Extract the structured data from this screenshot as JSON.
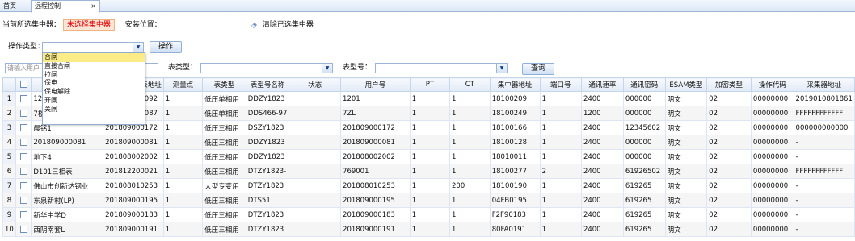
{
  "tabs": {
    "home": "首页",
    "remote": "远程控制",
    "close": "×"
  },
  "concentrator": {
    "label": "当前所选集中器：",
    "selected": "未选择集中器",
    "install_label": "安装位置：",
    "clear_button": "清除已选集中器"
  },
  "operation": {
    "label": "操作类型：",
    "button": "操作",
    "options": [
      "合闸",
      "直接合闸",
      "拉闸",
      "保电",
      "保电解除",
      "开闸",
      "关闸"
    ]
  },
  "filters": {
    "user_placeholder": "请输入用户",
    "table_type_label": "表类型：",
    "model_label": "表型号：",
    "query_button": "查询"
  },
  "table": {
    "columns": [
      "",
      "",
      "表地址",
      "测量点",
      "表类型",
      "表型号名称",
      "状态",
      "用户号",
      "PT",
      "CT",
      "集中器地址",
      "端口号",
      "通讯速率",
      "通讯密码",
      "ESAM类型",
      "加密类型",
      "操作代码",
      "采集器地址"
    ],
    "rows": [
      [
        "1",
        "",
        "120",
        "180800000092",
        "1",
        "低压单相用",
        "DDZY1823",
        "",
        "1201",
        "1",
        "1",
        "18100209",
        "1",
        "2400",
        "000000",
        "明文",
        "02",
        "00000000",
        "2019010801861"
      ],
      [
        "2",
        "",
        "7楼",
        "180800000087",
        "1",
        "低压单相用",
        "DDS466-97",
        "",
        "7ZL",
        "1",
        "1",
        "18100249",
        "1",
        "1200",
        "000000",
        "明文",
        "02",
        "00000000",
        "FFFFFFFFFFFF"
      ],
      [
        "3",
        "",
        "晨铭1",
        "201809000172",
        "1",
        "低压三相用",
        "DSZY1823",
        "",
        "201809000172",
        "1",
        "1",
        "18100166",
        "1",
        "2400",
        "12345602",
        "明文",
        "02",
        "00000000",
        "000000000000"
      ],
      [
        "4",
        "",
        "201809000081",
        "201809000081",
        "1",
        "低压三相用",
        "DDZY1823",
        "",
        "201809000081",
        "1",
        "1",
        "18100128",
        "1",
        "2400",
        "000000",
        "明文",
        "02",
        "00000000",
        "-"
      ],
      [
        "5",
        "",
        "地下4",
        "201808002002",
        "1",
        "低压三相用",
        "DDZY1823",
        "",
        "201808002002",
        "1",
        "1",
        "18010011",
        "1",
        "2400",
        "000000",
        "明文",
        "02",
        "00000000",
        "-"
      ],
      [
        "6",
        "",
        "D101三相表",
        "201812200021",
        "1",
        "低压三相用",
        "DTZY1823-",
        "",
        "769001",
        "1",
        "1",
        "18100277",
        "2",
        "2400",
        "61926502",
        "明文",
        "02",
        "00000000",
        "FFFFFFFFFFFF"
      ],
      [
        "7",
        "",
        "佛山市创新达钢业",
        "201808010253",
        "1",
        "大型专变用",
        "DTZY1823",
        "",
        "201808010253",
        "1",
        "200",
        "18100190",
        "1",
        "2400",
        "619265",
        "明文",
        "02",
        "00000000",
        "-"
      ],
      [
        "8",
        "",
        "东泉新村(LP)",
        "201809000195",
        "1",
        "低压三相用",
        "DTS51",
        "",
        "201809000195",
        "1",
        "1",
        "04FB0195",
        "1",
        "2400",
        "619265",
        "明文",
        "02",
        "00000000",
        "-"
      ],
      [
        "9",
        "",
        "新华中学D",
        "201809000183",
        "1",
        "低压三相用",
        "DTZY1823",
        "",
        "201809000183",
        "1",
        "1",
        "F2F90183",
        "1",
        "2400",
        "619265",
        "明文",
        "02",
        "00000000",
        "-"
      ],
      [
        "10",
        "",
        "西阴南套L",
        "201809000191",
        "1",
        "低压三相用",
        "DTZY1823",
        "",
        "201809000191",
        "1",
        "1",
        "80FA0191",
        "1",
        "2400",
        "619265",
        "明文",
        "02",
        "00000000",
        "-"
      ]
    ]
  },
  "colors": {
    "accent": "#15428b",
    "selected_bg": "#fbec88",
    "warning": "#e00000"
  },
  "icons": {
    "clear": "eraser-icon",
    "dropdown": "chevron-down-icon"
  }
}
